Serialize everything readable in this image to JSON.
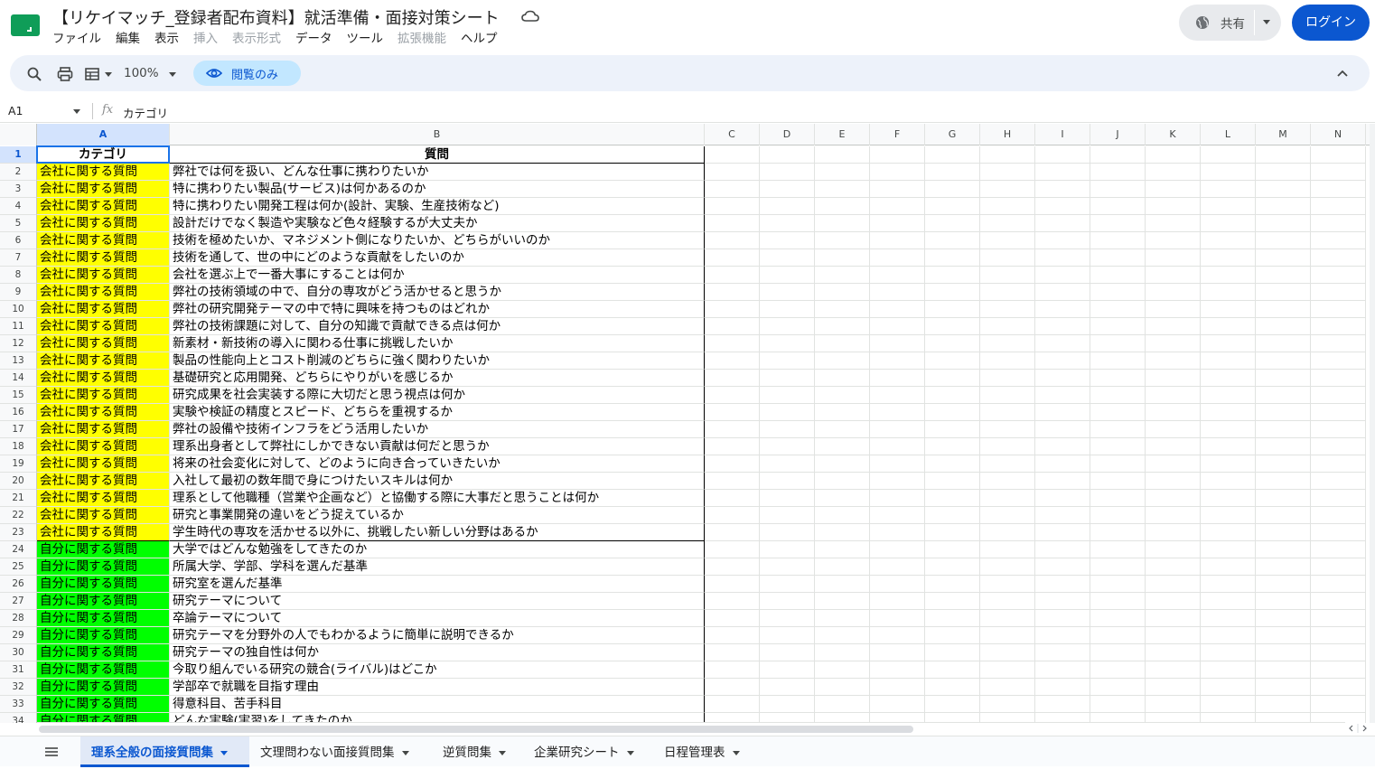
{
  "header": {
    "title": "【リケイマッチ_登録者配布資料】就活準備・面接対策シート",
    "menu": [
      {
        "label": "ファイル",
        "disabled": false
      },
      {
        "label": "編集",
        "disabled": false
      },
      {
        "label": "表示",
        "disabled": false
      },
      {
        "label": "挿入",
        "disabled": true
      },
      {
        "label": "表示形式",
        "disabled": true
      },
      {
        "label": "データ",
        "disabled": false
      },
      {
        "label": "ツール",
        "disabled": false
      },
      {
        "label": "拡張機能",
        "disabled": true
      },
      {
        "label": "ヘルプ",
        "disabled": false
      }
    ],
    "share_label": "共有",
    "login_label": "ログイン"
  },
  "toolbar": {
    "zoom": "100%",
    "view_only_label": "閲覧のみ"
  },
  "formula_bar": {
    "cell_ref": "A1",
    "content": "カテゴリ"
  },
  "grid": {
    "columns": [
      "A",
      "B",
      "C",
      "D",
      "E",
      "F",
      "G",
      "H",
      "I",
      "J",
      "K",
      "L",
      "M",
      "N"
    ],
    "header_row": {
      "num": "1",
      "a": "カテゴリ",
      "b": "質問"
    },
    "rows": [
      {
        "num": "2",
        "a": "会社に関する質問",
        "b": "弊社では何を扱い、どんな仕事に携わりたいか",
        "color": "yellow"
      },
      {
        "num": "3",
        "a": "会社に関する質問",
        "b": "特に携わりたい製品(サービス)は何かあるのか",
        "color": "yellow"
      },
      {
        "num": "4",
        "a": "会社に関する質問",
        "b": "特に携わりたい開発工程は何か(設計、実験、生産技術など)",
        "color": "yellow"
      },
      {
        "num": "5",
        "a": "会社に関する質問",
        "b": "設計だけでなく製造や実験など色々経験するが大丈夫か",
        "color": "yellow"
      },
      {
        "num": "6",
        "a": "会社に関する質問",
        "b": "技術を極めたいか、マネジメント側になりたいか、どちらがいいのか",
        "color": "yellow"
      },
      {
        "num": "7",
        "a": "会社に関する質問",
        "b": "技術を通して、世の中にどのような貢献をしたいのか",
        "color": "yellow"
      },
      {
        "num": "8",
        "a": "会社に関する質問",
        "b": "会社を選ぶ上で一番大事にすることは何か",
        "color": "yellow"
      },
      {
        "num": "9",
        "a": "会社に関する質問",
        "b": "弊社の技術領域の中で、自分の専攻がどう活かせると思うか",
        "color": "yellow"
      },
      {
        "num": "10",
        "a": "会社に関する質問",
        "b": "弊社の研究開発テーマの中で特に興味を持つものはどれか",
        "color": "yellow"
      },
      {
        "num": "11",
        "a": "会社に関する質問",
        "b": "弊社の技術課題に対して、自分の知識で貢献できる点は何か",
        "color": "yellow"
      },
      {
        "num": "12",
        "a": "会社に関する質問",
        "b": "新素材・新技術の導入に関わる仕事に挑戦したいか",
        "color": "yellow"
      },
      {
        "num": "13",
        "a": "会社に関する質問",
        "b": "製品の性能向上とコスト削減のどちらに強く関わりたいか",
        "color": "yellow"
      },
      {
        "num": "14",
        "a": "会社に関する質問",
        "b": "基礎研究と応用開発、どちらにやりがいを感じるか",
        "color": "yellow"
      },
      {
        "num": "15",
        "a": "会社に関する質問",
        "b": "研究成果を社会実装する際に大切だと思う視点は何か",
        "color": "yellow"
      },
      {
        "num": "16",
        "a": "会社に関する質問",
        "b": "実験や検証の精度とスピード、どちらを重視するか",
        "color": "yellow"
      },
      {
        "num": "17",
        "a": "会社に関する質問",
        "b": "弊社の設備や技術インフラをどう活用したいか",
        "color": "yellow"
      },
      {
        "num": "18",
        "a": "会社に関する質問",
        "b": "理系出身者として弊社にしかできない貢献は何だと思うか",
        "color": "yellow"
      },
      {
        "num": "19",
        "a": "会社に関する質問",
        "b": "将来の社会変化に対して、どのように向き合っていきたいか",
        "color": "yellow"
      },
      {
        "num": "20",
        "a": "会社に関する質問",
        "b": "入社して最初の数年間で身につけたいスキルは何か",
        "color": "yellow"
      },
      {
        "num": "21",
        "a": "会社に関する質問",
        "b": "理系として他職種（営業や企画など）と協働する際に大事だと思うことは何か",
        "color": "yellow"
      },
      {
        "num": "22",
        "a": "会社に関する質問",
        "b": "研究と事業開発の違いをどう捉えているか",
        "color": "yellow"
      },
      {
        "num": "23",
        "a": "会社に関する質問",
        "b": "学生時代の専攻を活かせる以外に、挑戦したい新しい分野はあるか",
        "color": "yellow"
      },
      {
        "num": "24",
        "a": "自分に関する質問",
        "b": "大学ではどんな勉強をしてきたのか",
        "color": "green"
      },
      {
        "num": "25",
        "a": "自分に関する質問",
        "b": "所属大学、学部、学科を選んだ基準",
        "color": "green"
      },
      {
        "num": "26",
        "a": "自分に関する質問",
        "b": "研究室を選んだ基準",
        "color": "green"
      },
      {
        "num": "27",
        "a": "自分に関する質問",
        "b": "研究テーマについて",
        "color": "green"
      },
      {
        "num": "28",
        "a": "自分に関する質問",
        "b": "卒論テーマについて",
        "color": "green"
      },
      {
        "num": "29",
        "a": "自分に関する質問",
        "b": "研究テーマを分野外の人でもわかるように簡単に説明できるか",
        "color": "green"
      },
      {
        "num": "30",
        "a": "自分に関する質問",
        "b": "研究テーマの独自性は何か",
        "color": "green"
      },
      {
        "num": "31",
        "a": "自分に関する質問",
        "b": "今取り組んでいる研究の競合(ライバル)はどこか",
        "color": "green"
      },
      {
        "num": "32",
        "a": "自分に関する質問",
        "b": "学部卒で就職を目指す理由",
        "color": "green"
      },
      {
        "num": "33",
        "a": "自分に関する質問",
        "b": "得意科目、苦手科目",
        "color": "green"
      },
      {
        "num": "34",
        "a": "自分に関する質問",
        "b": "どんな実験(実習)をしてきたのか",
        "color": "green"
      }
    ]
  },
  "sheet_tabs": [
    {
      "label": "理系全般の面接質問集",
      "active": true
    },
    {
      "label": "文理問わない面接質問集",
      "active": false
    },
    {
      "label": "逆質問集",
      "active": false
    },
    {
      "label": "企業研究シート",
      "active": false
    },
    {
      "label": "日程管理表",
      "active": false
    }
  ],
  "colors": {
    "accent": "#0b57d0",
    "company_category": "#ffff00",
    "self_category": "#00ff00"
  }
}
